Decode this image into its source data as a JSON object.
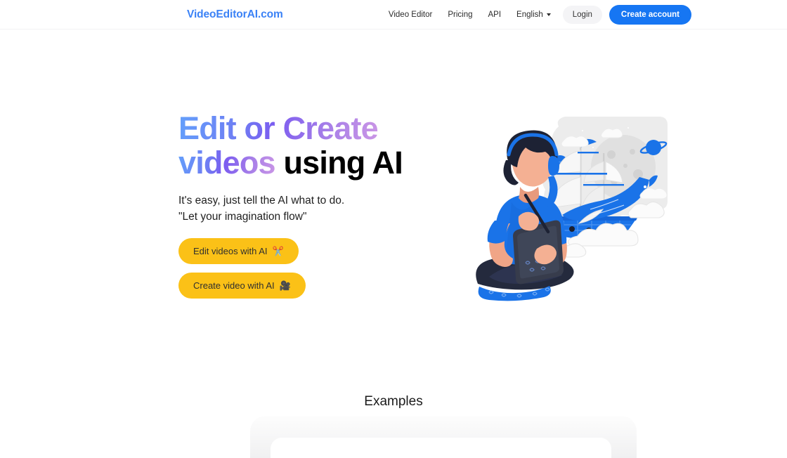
{
  "navbar": {
    "logo": "VideoEditorAI.com",
    "links": [
      {
        "label": "Video Editor"
      },
      {
        "label": "Pricing"
      },
      {
        "label": "API"
      }
    ],
    "language": {
      "label": "English",
      "caret_icon": "chevron-down-icon"
    },
    "login_label": "Login",
    "create_account_label": "Create account",
    "accent_color": "#1676f3",
    "logo_color": "#3b82f6"
  },
  "hero": {
    "headline_gradient_part": "Edit or Create videos",
    "headline_line1_grad": "Edit or Create",
    "headline_line2_grad": "videos",
    "headline_plain": "using AI",
    "subtitle_line1": "It's easy, just tell the AI what to do.",
    "subtitle_line2": "\"Let your imagination flow\"",
    "buttons": [
      {
        "label": "Edit videos with AI",
        "emoji": "✂️",
        "icon": "scissors-icon",
        "color": "#fbc117"
      },
      {
        "label": "Create video with AI",
        "emoji": "🎥",
        "icon": "movie-camera-icon",
        "color": "#fbc117"
      }
    ],
    "illustration_alt": "person sitting cross-legged with tablet imagining a sailing ship, moon, planet and whale"
  },
  "examples": {
    "title": "Examples"
  }
}
